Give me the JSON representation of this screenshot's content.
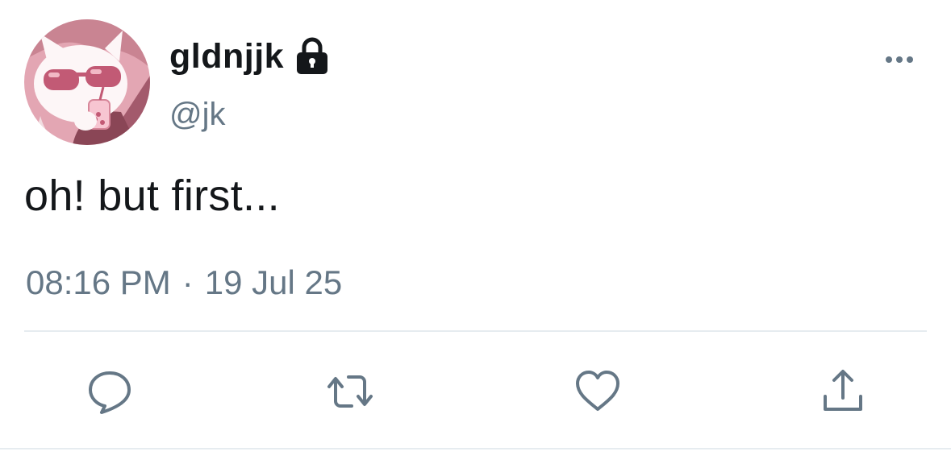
{
  "tweet": {
    "display_name": "gldnjjk",
    "handle": "@jk",
    "text": "oh! but first...",
    "time": "08:16 PM",
    "separator": "·",
    "date": "19 Jul 25",
    "protected": true
  },
  "icons": {
    "lock": "lock-icon",
    "more": "more-horizontal-icon",
    "reply": "reply-bubble-icon",
    "retweet": "retweet-icon",
    "like": "heart-icon",
    "share": "share-icon"
  },
  "colors": {
    "text_primary": "#14171a",
    "text_secondary": "#657786",
    "icon": "#657786",
    "divider": "#e6ecf0",
    "avatar_pink": "#e8a8b4"
  }
}
